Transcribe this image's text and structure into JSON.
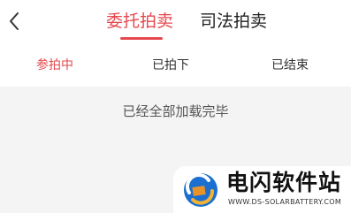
{
  "header": {
    "back_icon": "chevron-left-icon",
    "tabs": [
      {
        "label": "委托拍卖",
        "active": true
      },
      {
        "label": "司法拍卖",
        "active": false
      }
    ]
  },
  "subnav": {
    "tabs": [
      {
        "label": "参拍中",
        "active": true
      },
      {
        "label": "已拍下",
        "active": false
      },
      {
        "label": "已结束",
        "active": false
      }
    ]
  },
  "content": {
    "status_text": "已经全部加载完毕"
  },
  "watermark": {
    "title": "电闪软件站",
    "url": "WWW.DS-SOLARBATTERY.COM"
  },
  "colors": {
    "accent": "#e5484d",
    "background": "#f4f4f4"
  }
}
